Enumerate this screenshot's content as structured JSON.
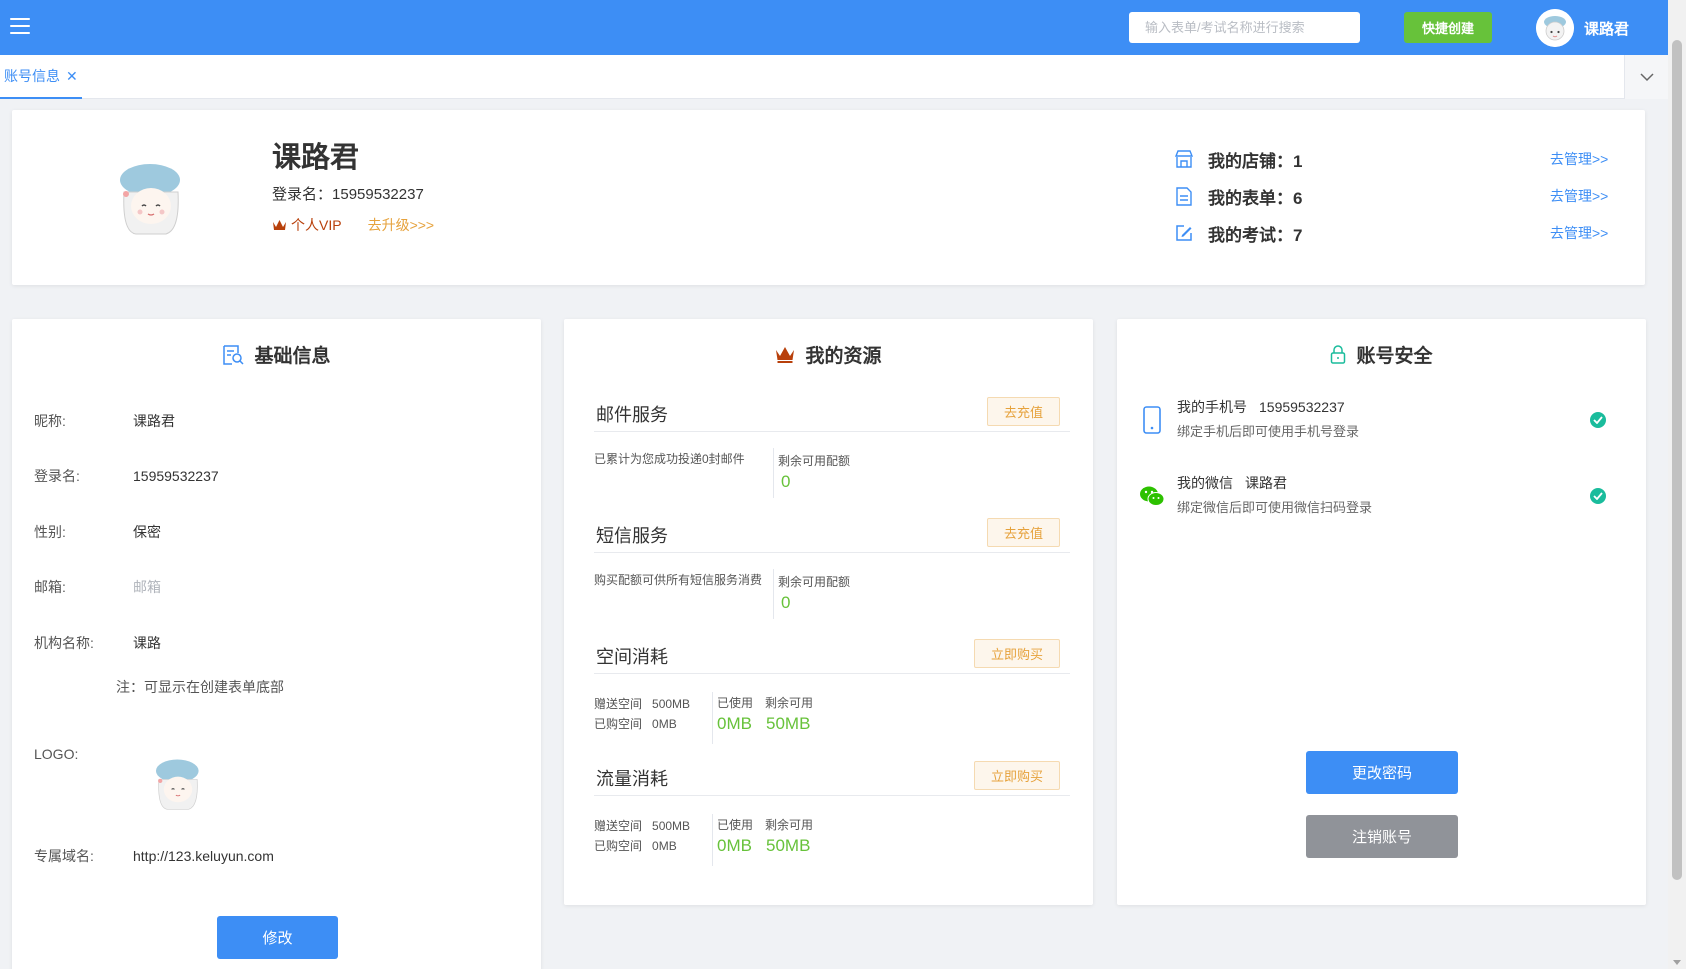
{
  "header": {
    "search_placeholder": "输入表单/考试名称进行搜索",
    "quick_create": "快捷创建",
    "username": "课路君"
  },
  "tabs": [
    {
      "label": "账号信息",
      "close": "✕"
    }
  ],
  "profile": {
    "name": "课路君",
    "login_label": "登录名：",
    "login_value": "15959532237",
    "vip_label": "个人VIP",
    "upgrade_label": "去升级>>>",
    "stats": [
      {
        "label": "我的店铺：1",
        "icon": "store-icon",
        "link": "去管理>>"
      },
      {
        "label": "我的表单：6",
        "icon": "document-icon",
        "link": "去管理>>"
      },
      {
        "label": "我的考试：7",
        "icon": "edit-icon",
        "link": "去管理>>"
      }
    ]
  },
  "basic": {
    "title": "基础信息",
    "rows": [
      {
        "key": "昵称:",
        "value": "课路君"
      },
      {
        "key": "登录名:",
        "value": "15959532237"
      },
      {
        "key": "性别:",
        "value": "保密"
      },
      {
        "key": "邮箱:",
        "value": "邮箱"
      },
      {
        "key": "机构名称:",
        "value": "课路"
      }
    ],
    "note": "注：可显示在创建表单底部",
    "logo_label": "LOGO:",
    "domain_label": "专属域名:",
    "domain_value": "http://123.keluyun.com",
    "edit_button": "修改"
  },
  "resources": {
    "title": "我的资源",
    "sections": [
      {
        "name": "邮件服务",
        "button": "去充值",
        "desc": "已累计为您成功投递0封邮件",
        "remain_label": "剩余可用配额",
        "remain_value": "0"
      },
      {
        "name": "短信服务",
        "button": "去充值",
        "desc": "购买配额可供所有短信服务消费",
        "remain_label": "剩余可用配额",
        "remain_value": "0"
      },
      {
        "name": "空间消耗",
        "button": "立即购买",
        "gift": "赠送空间",
        "gift_val": "500MB",
        "bought": "已购空间",
        "bought_val": "0MB",
        "used_label": "已使用",
        "avail_label": "剩余可用",
        "used_value": "0MB",
        "avail_value": "50MB"
      },
      {
        "name": "流量消耗",
        "button": "立即购买",
        "gift": "赠送空间",
        "gift_val": "500MB",
        "bought": "已购空间",
        "bought_val": "0MB",
        "used_label": "已使用",
        "avail_label": "剩余可用",
        "used_value": "0MB",
        "avail_value": "50MB"
      }
    ]
  },
  "security": {
    "title": "账号安全",
    "phone_label": "我的手机号",
    "phone_value": "15959532237",
    "phone_hint": "绑定手机后即可使用手机号登录",
    "wechat_label": "我的微信",
    "wechat_value": "课路君",
    "wechat_hint": "绑定微信后即可使用微信扫码登录",
    "change_password": "更改密码",
    "cancel_account": "注销账号"
  },
  "colors": {
    "primary": "#3d8ef5",
    "success": "#67c23a",
    "warning": "#e6a23c",
    "vip": "#b8400b",
    "check": "#1abc9c"
  }
}
